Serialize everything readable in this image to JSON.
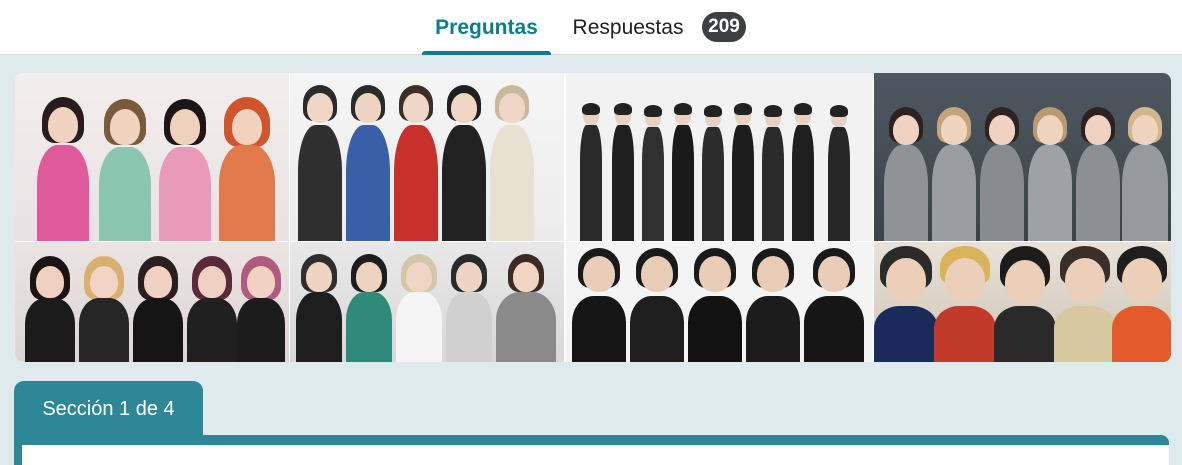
{
  "tabs": {
    "questions_label": "Preguntas",
    "responses_label": "Respuestas",
    "responses_count": "209"
  },
  "header_image": {
    "icon": "group-photo-collage"
  },
  "section": {
    "label": "Sección 1 de 4"
  },
  "colors": {
    "accent": "#0b7f89",
    "section": "#2d8797",
    "background": "#dfeaee",
    "badge": "#3c4043"
  }
}
